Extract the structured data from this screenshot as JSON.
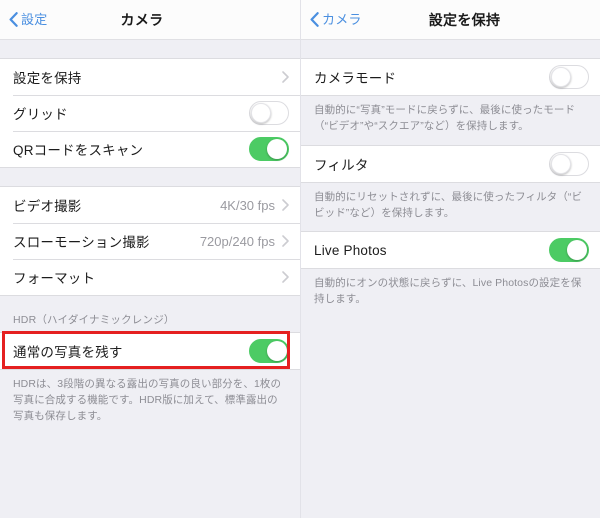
{
  "left_panel": {
    "navbar": {
      "back_label": "設定",
      "title": "カメラ",
      "back_icon": "chevron-left-icon"
    },
    "group1": [
      {
        "label": "設定を保持",
        "type": "disclosure",
        "value": "",
        "accessory": "chevron-right-icon"
      },
      {
        "label": "グリッド",
        "type": "toggle",
        "state": "off"
      },
      {
        "label": "QRコードをスキャン",
        "type": "toggle",
        "state": "on"
      }
    ],
    "group2": [
      {
        "label": "ビデオ撮影",
        "type": "disclosure",
        "value": "4K/30 fps",
        "accessory": "chevron-right-icon"
      },
      {
        "label": "スローモーション撮影",
        "type": "disclosure",
        "value": "720p/240 fps",
        "accessory": "chevron-right-icon"
      },
      {
        "label": "フォーマット",
        "type": "disclosure",
        "value": "",
        "accessory": "chevron-right-icon"
      }
    ],
    "hdr_section": {
      "header": "HDR（ハイダイナミックレンジ）",
      "row": {
        "label": "通常の写真を残す",
        "type": "toggle",
        "state": "on"
      },
      "footer": "HDRは、3段階の異なる露出の写真の良い部分を、1枚の写真に合成する機能です。HDR版に加えて、標準露出の写真も保存します。",
      "highlighted": true
    }
  },
  "right_panel": {
    "navbar": {
      "back_label": "カメラ",
      "title": "設定を保持",
      "back_icon": "chevron-left-icon"
    },
    "sections": [
      {
        "row": {
          "label": "カメラモード",
          "type": "toggle",
          "state": "off"
        },
        "footer": "自動的に“写真”モードに戻らずに、最後に使ったモード（“ビデオ”や“スクエア”など）を保持します。",
        "highlighted": false
      },
      {
        "row": {
          "label": "フィルタ",
          "type": "toggle",
          "state": "off"
        },
        "footer": "自動的にリセットされずに、最後に使ったフィルタ（“ビビッド”など）を保持します。",
        "highlighted": false
      },
      {
        "row": {
          "label": "Live Photos",
          "type": "toggle",
          "state": "on"
        },
        "footer": "自動的にオンの状態に戻らずに、Live Photosの設定を保持します。",
        "highlighted": true
      }
    ]
  },
  "colors": {
    "accent_blue": "#4a8fe0",
    "toggle_on_green": "#4ccb64",
    "annotation_red": "#e52020",
    "background": "#efeff4",
    "row_background": "#ffffff",
    "secondary_text": "#8d8d94"
  }
}
